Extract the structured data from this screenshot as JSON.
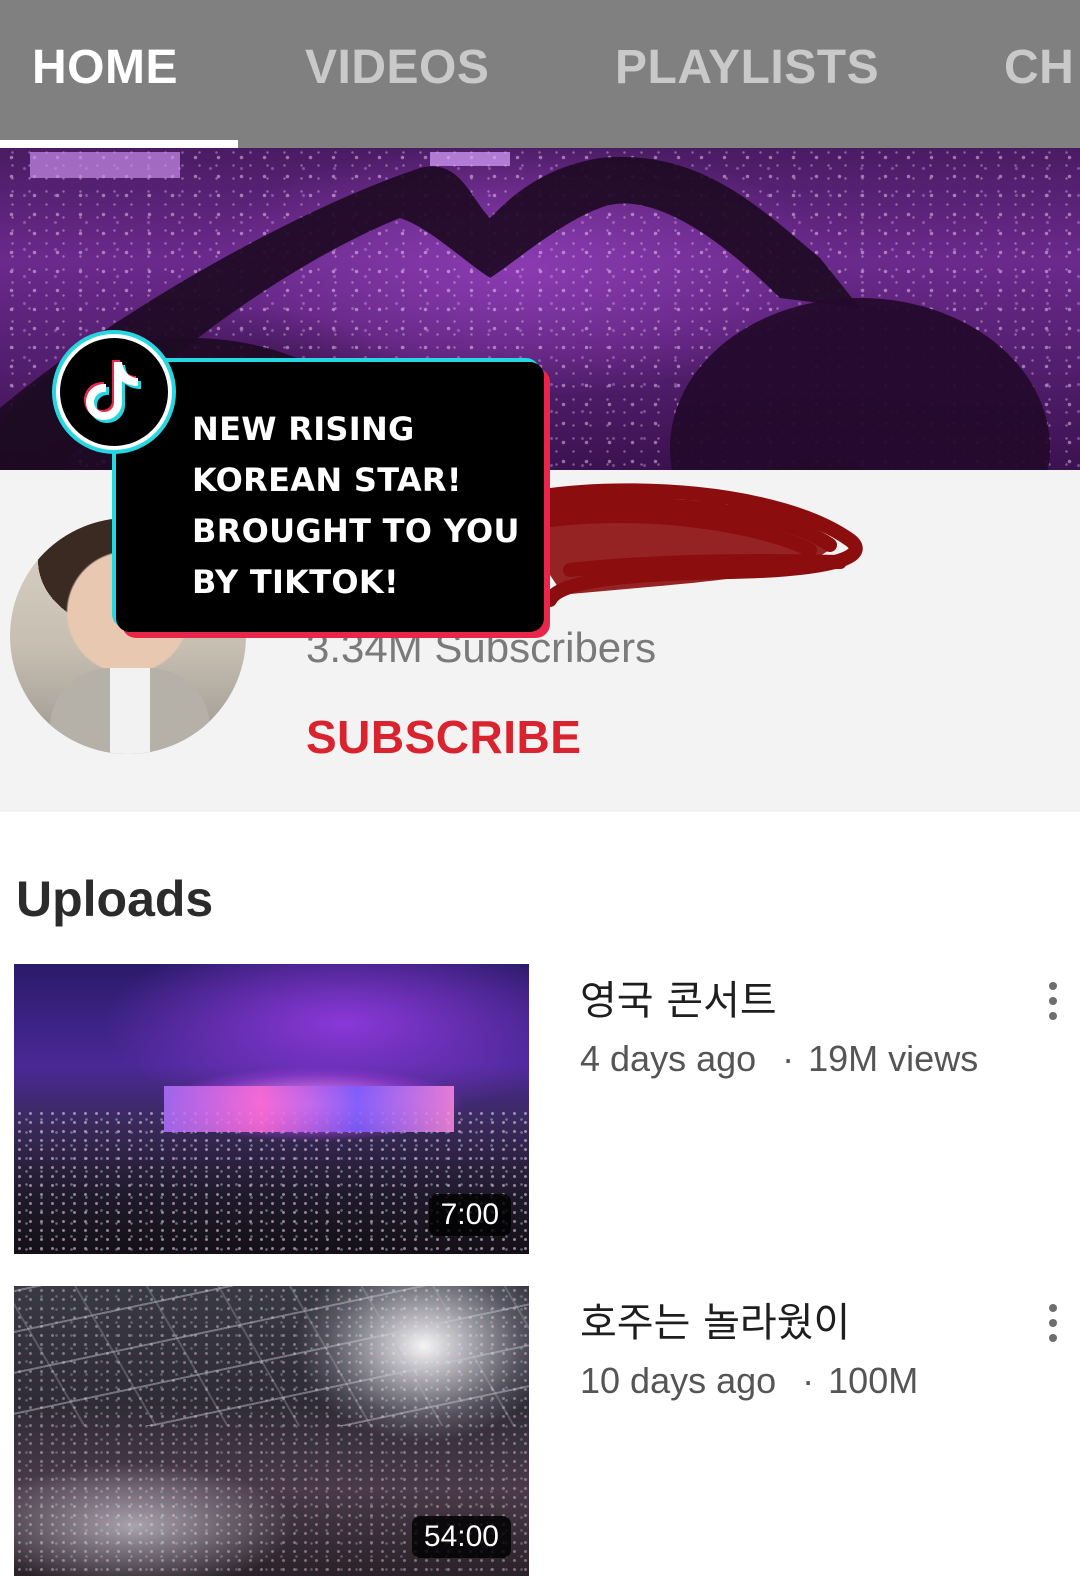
{
  "tabs": [
    {
      "label": "HOME",
      "active": true
    },
    {
      "label": "VIDEOS",
      "active": false
    },
    {
      "label": "PLAYLISTS",
      "active": false
    },
    {
      "label": "CH",
      "active": false
    }
  ],
  "overlay": {
    "lines": [
      "NEW RISING",
      "KOREAN STAR!",
      "BROUGHT TO YOU",
      "BY TIKTOK!"
    ],
    "icon": "tiktok-icon"
  },
  "channel": {
    "subscribers": "3.34M Subscribers",
    "subscribe_label": "SUBSCRIBE"
  },
  "uploads": {
    "heading": "Uploads",
    "videos": [
      {
        "title": "영국 콘서트",
        "age": "4 days ago",
        "views": "19M views",
        "duration": "7:00"
      },
      {
        "title": "호주는 놀라웠이",
        "age": "10 days ago",
        "views": "100M",
        "duration": "54:00"
      }
    ]
  },
  "colors": {
    "tabbar_bg": "#808080",
    "subscribe_red": "#d9232e",
    "tiktok_cyan": "#25d7e0",
    "tiktok_red": "#e8264a",
    "redaction": "#8b0d0d"
  }
}
